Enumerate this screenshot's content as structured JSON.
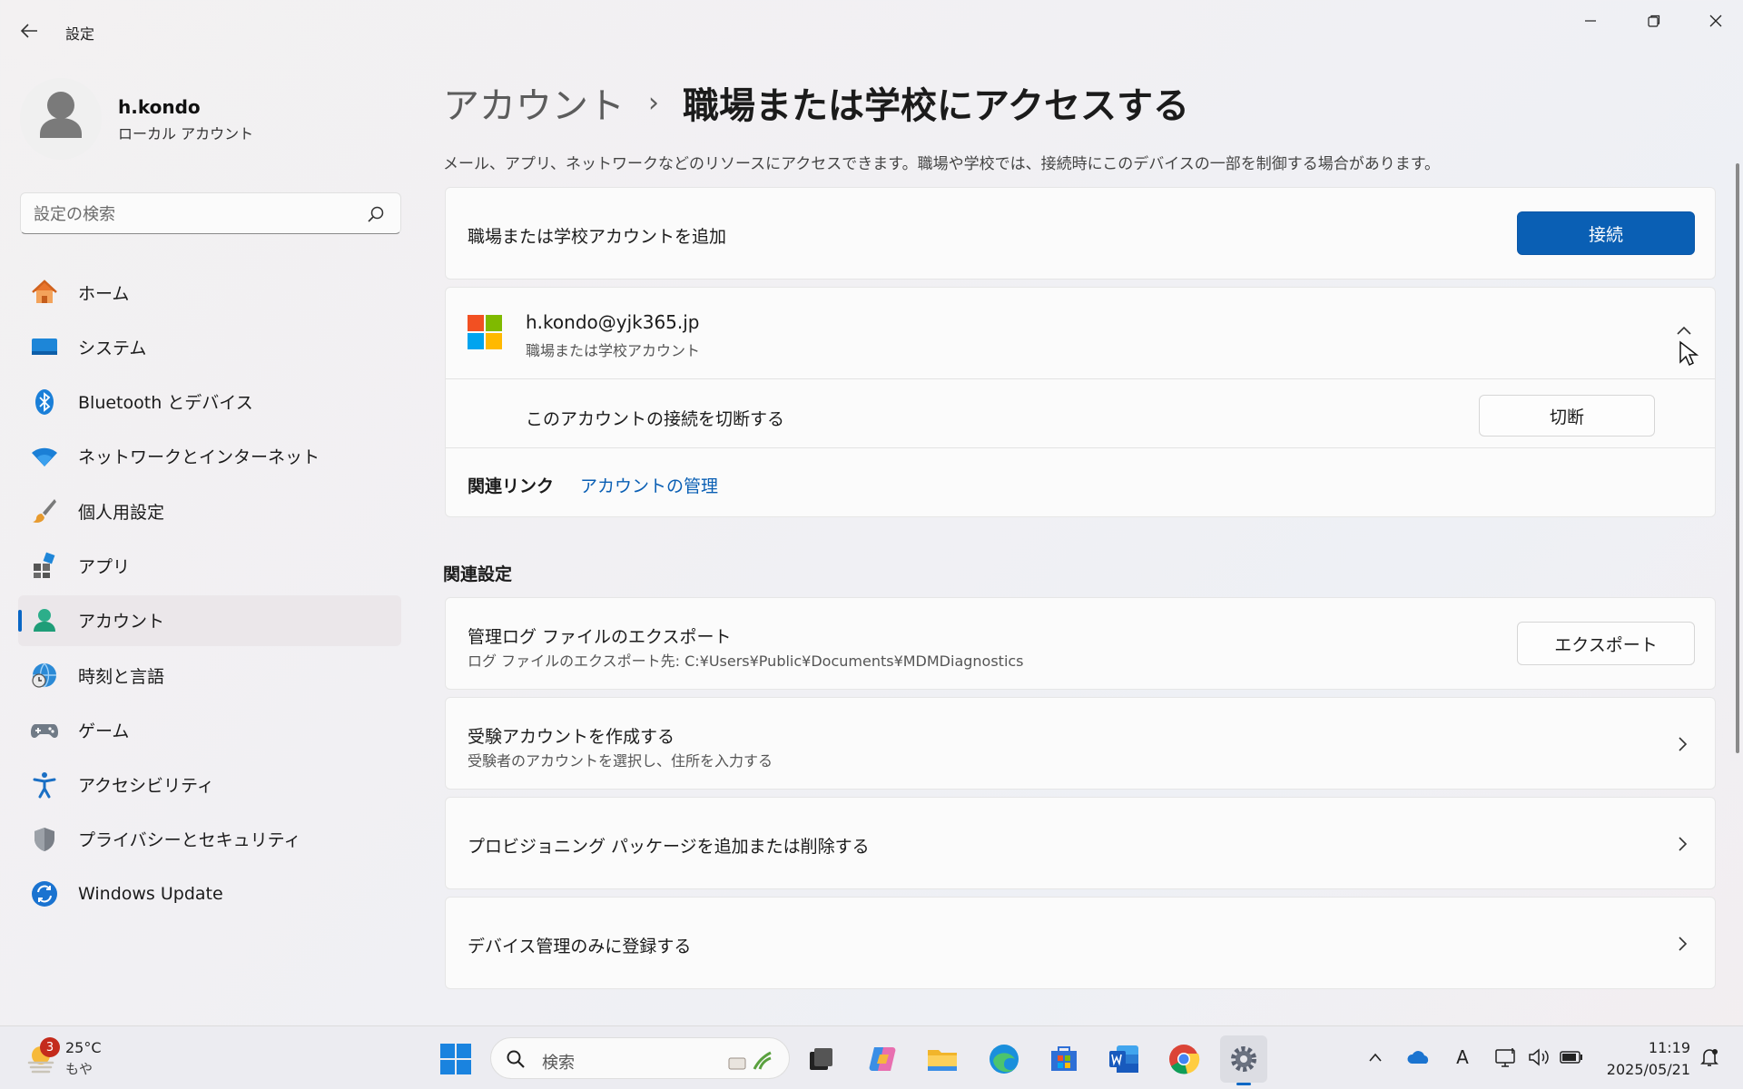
{
  "window": {
    "title": "設定"
  },
  "user": {
    "name": "h.kondo",
    "account_type": "ローカル アカウント"
  },
  "search": {
    "placeholder": "設定の検索"
  },
  "nav": {
    "items": [
      {
        "label": "ホーム",
        "icon": "home-icon"
      },
      {
        "label": "システム",
        "icon": "system-icon"
      },
      {
        "label": "Bluetooth とデバイス",
        "icon": "bluetooth-icon"
      },
      {
        "label": "ネットワークとインターネット",
        "icon": "wifi-icon"
      },
      {
        "label": "個人用設定",
        "icon": "brush-icon"
      },
      {
        "label": "アプリ",
        "icon": "apps-icon"
      },
      {
        "label": "アカウント",
        "icon": "account-icon",
        "active": true
      },
      {
        "label": "時刻と言語",
        "icon": "clock-globe-icon"
      },
      {
        "label": "ゲーム",
        "icon": "gamepad-icon"
      },
      {
        "label": "アクセシビリティ",
        "icon": "accessibility-icon"
      },
      {
        "label": "プライバシーとセキュリティ",
        "icon": "shield-icon"
      },
      {
        "label": "Windows Update",
        "icon": "update-icon"
      }
    ]
  },
  "header": {
    "parent": "アカウント",
    "separator": "›",
    "current": "職場または学校にアクセスする",
    "description": "メール、アプリ、ネットワークなどのリソースにアクセスできます。職場や学校では、接続時にこのデバイスの一部を制御する場合があります。"
  },
  "add_account": {
    "label": "職場または学校アカウントを追加",
    "button": "接続"
  },
  "connected_account": {
    "email": "h.kondo@yjk365.jp",
    "type": "職場または学校アカウント",
    "disconnect_label": "このアカウントの接続を切断する",
    "disconnect_button": "切断",
    "related_links_label": "関連リンク",
    "manage_link": "アカウントの管理"
  },
  "related_settings": {
    "title": "関連設定",
    "export": {
      "title": "管理ログ ファイルのエクスポート",
      "subtitle": "ログ ファイルのエクスポート先: C:¥Users¥Public¥Documents¥MDMDiagnostics",
      "button": "エクスポート"
    },
    "exam": {
      "title": "受験アカウントを作成する",
      "subtitle": "受験者のアカウントを選択し、住所を入力する"
    },
    "provisioning": {
      "title": "プロビジョニング パッケージを追加または削除する"
    },
    "device_mgmt": {
      "title": "デバイス管理のみに登録する"
    }
  },
  "taskbar": {
    "weather_temp": "25°C",
    "weather_desc": "もや",
    "weather_badge": "3",
    "search_placeholder": "検索",
    "ime": "A",
    "time": "11:19",
    "date": "2025/05/21"
  },
  "colors": {
    "accent": "#0a5fb4",
    "link": "#0a5fb4"
  }
}
